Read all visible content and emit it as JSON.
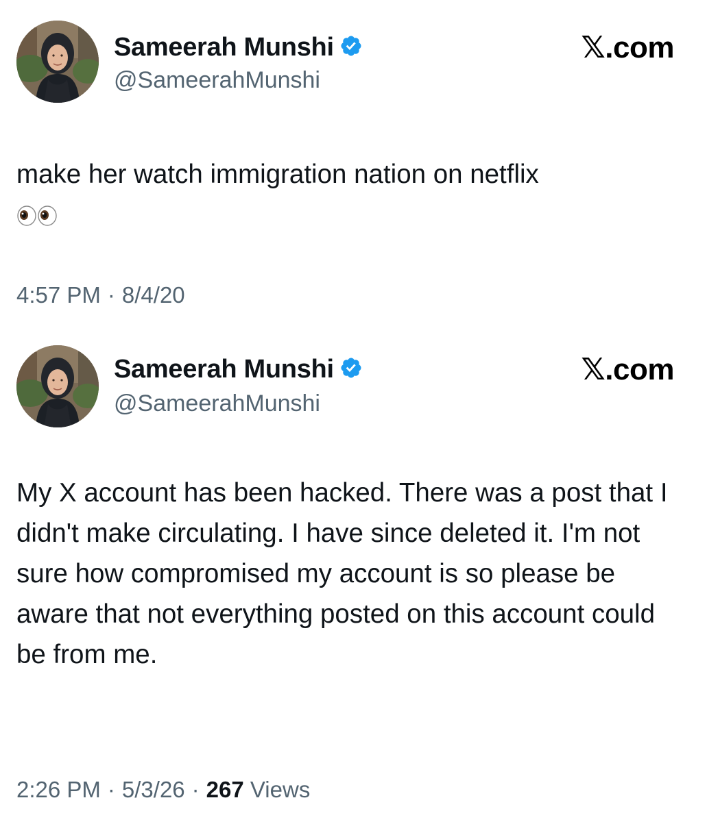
{
  "tweets": [
    {
      "author": {
        "display_name": "Sameerah Munshi",
        "handle": "@SameerahMunshi",
        "verified": true
      },
      "site_label": "𝕏.com",
      "text": "make her watch immigration nation on netflix",
      "emoji": "eyes-icon",
      "time": "4:57 PM",
      "date": "8/4/20"
    },
    {
      "author": {
        "display_name": "Sameerah Munshi",
        "handle": "@SameerahMunshi",
        "verified": true
      },
      "site_label": "𝕏.com",
      "text": "My X account has been hacked. There was a post that I didn't make circulating. I have since deleted it. I'm not sure how compromised my account is so please be aware that not everything posted on this account could be from me.",
      "time": "2:26 PM",
      "date": "5/3/26",
      "views_count": "267",
      "views_label": "Views"
    }
  ],
  "colors": {
    "text": "#0f1419",
    "secondary": "#536471",
    "verified": "#1d9bf0",
    "background": "#ffffff"
  }
}
